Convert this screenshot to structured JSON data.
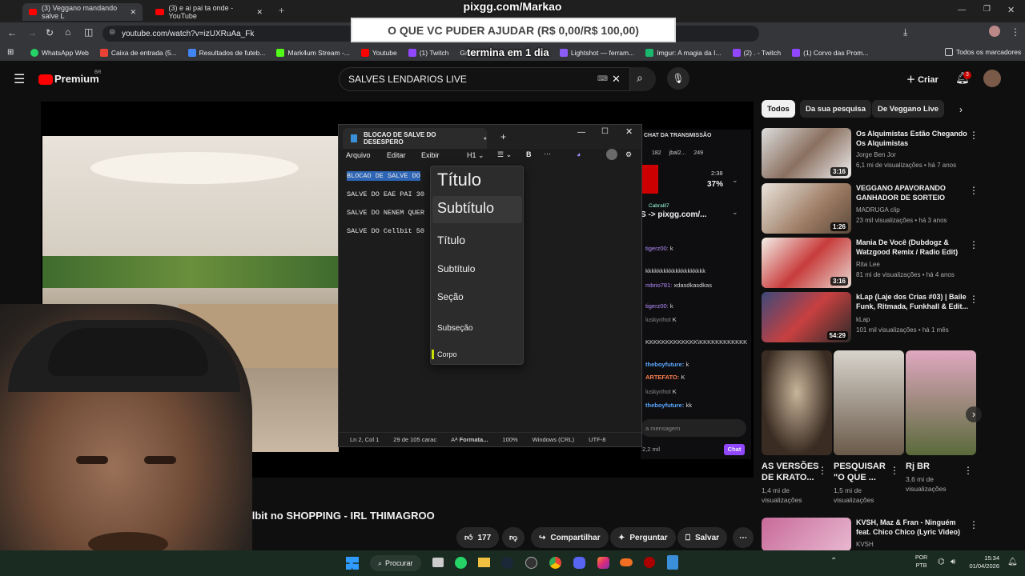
{
  "browser": {
    "tabs": [
      {
        "title": "(3) Veggano mandando salve L",
        "active": true
      },
      {
        "title": "(3) e ai pai ta onde - YouTube",
        "active": false
      }
    ],
    "url": "youtube.com/watch?v=izUXRuAa_Fk",
    "bookmarks": [
      "WhatsApp Web",
      "Caixa de entrada (5...",
      "Resultados de futeb...",
      "Mark4um Stream -...",
      "Youtube",
      "(1) Twitch",
      "Grok",
      "Lightshot — ferram...",
      "Imgur: A magia da I...",
      "(2) . - Twitch",
      "(1) Corvo das Prom..."
    ],
    "all_bookmarks": "Todos os marcadores"
  },
  "overlay": {
    "title": "pixgg.com/Markao",
    "donation": "O QUE VC PUDER AJUDAR (R$ 0,00/R$ 100,00)",
    "timer": "termina em 1 dia"
  },
  "youtube": {
    "logo": "Premium",
    "region": "BR",
    "search_value": "SALVES LENDARIOS LIVE",
    "create_label": "Criar",
    "notif_count": "3",
    "video_title": "do Cellbit no SHOPPING - IRL THIMAGROO",
    "likes": "177",
    "share": "Compartilhar",
    "ask": "Perguntar",
    "save": "Salvar"
  },
  "chat": {
    "header": "CHAT DA TRANSMISSÃO",
    "counters": [
      "182",
      "jbal2...",
      "249"
    ],
    "poll_time": "2:38",
    "poll_pct": "37%",
    "pinned_user": "Cabralil7",
    "pinned_text": "S -> pixgg.com/...",
    "messages": [
      {
        "user": "tigerz00:",
        "text": "k"
      },
      {
        "user": "mbrio781:",
        "text": "xdasdkasdkas"
      },
      {
        "user": "tigerz00:",
        "text": "k"
      },
      {
        "user": "",
        "text": "kkkkkkkkkkkkkkkkkkkk"
      },
      {
        "user": "luskynhot",
        "text": "K"
      },
      {
        "user": "",
        "text": "KKKKKKKKKKKKK\\KKKKKKKKKKKK"
      },
      {
        "user": "theboyfuture:",
        "text": "k"
      },
      {
        "user": "ARTEFATO:",
        "text": "K"
      },
      {
        "user": "luskynhot",
        "text": "K"
      },
      {
        "user": "theboyfuture:",
        "text": "kk"
      }
    ],
    "input_placeholder": "a mensagem",
    "viewers": "2,2 mil",
    "chat_button": "Chat"
  },
  "notepad": {
    "tab_title": "BLOCAO DE SALVE DO DESESPERO",
    "menu": [
      "Arquivo",
      "Editar",
      "Exibir"
    ],
    "heading_select": "H1",
    "lines": [
      "BLOCAO DE SALVE DO",
      "SALVE DO EAE PAI 30",
      "SALVE DO NENEM QUER",
      "SALVE DO Cellbit 50"
    ],
    "status": [
      "Ln 2, Col 1",
      "29 de 105 carac",
      "Formata...",
      "100%",
      "Windows (CRL)",
      "UTF-8"
    ],
    "dropdown": [
      "Título",
      "Subtítulo",
      "Título",
      "Subtítulo",
      "Seção",
      "Subseção",
      "Corpo"
    ]
  },
  "sidebar": {
    "chips": [
      "Todos",
      "Da sua pesquisa",
      "De Veggano Live"
    ],
    "videos": [
      {
        "title": "Os Alquimistas Estão Chegando Os Alquimistas",
        "channel": "Jorge Ben Jor",
        "meta": "6,1 mi de visualizações • há 7 anos",
        "duration": "3:16"
      },
      {
        "title": "VEGGANO APAVORANDO GANHADOR DE SORTEIO",
        "channel": "MADRUGA clip",
        "meta": "23 mil visualizações • há 3 anos",
        "duration": "1:26"
      },
      {
        "title": "Mania De Você (Dubdogz & Watzgood Remix / Radio Edit)",
        "channel": "Rita Lee",
        "meta": "81 mi de visualizações • há 4 anos",
        "duration": "3:16"
      },
      {
        "title": "kLap (Laje dos Crias #03) | Baile Funk, Ritmada, Funkhall & Edit...",
        "channel": "kLap",
        "meta": "101 mil visualizações • há 1 mês",
        "duration": "54:29"
      }
    ],
    "shorts": [
      {
        "title": "AS VERSÕES DE KRATO...",
        "meta": "1,4 mi de visualizações"
      },
      {
        "title": "PESQUISAR \"O QUE ...",
        "meta": "1,5 mi de visualizações"
      },
      {
        "title": "Rj BR",
        "meta": "3,6 mi de visualizações"
      }
    ],
    "last_video": {
      "title": "KVSH, Maz & Fran - Ninguém feat. Chico Chico (Lyric Video)",
      "channel": "KVSH"
    }
  },
  "taskbar": {
    "search": "Procurar",
    "lang": "POR",
    "kbd": "PTB",
    "time": "15:34",
    "date": "01/04/2026"
  }
}
